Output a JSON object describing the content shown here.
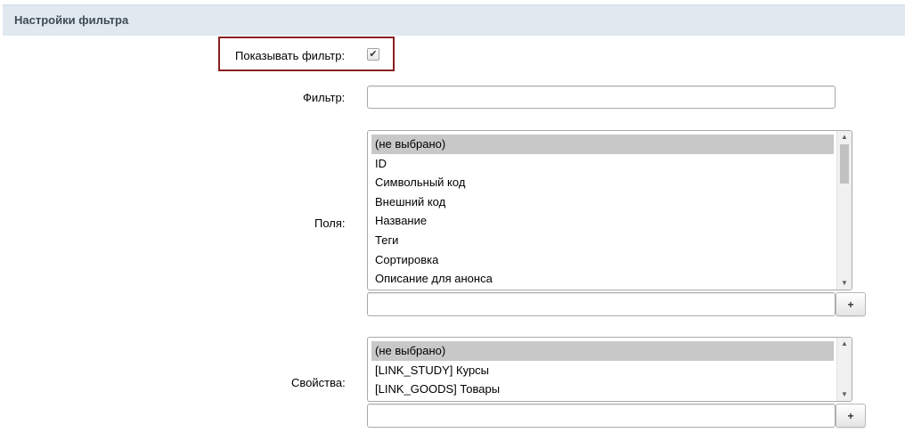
{
  "header": {
    "title": "Настройки фильтра"
  },
  "show_filter": {
    "label": "Показывать фильтр:",
    "checked": true,
    "check_glyph": "✔"
  },
  "filter": {
    "label": "Фильтр:",
    "value": ""
  },
  "fields": {
    "label": "Поля:",
    "options": [
      "(не выбрано)",
      "ID",
      "Символьный код",
      "Внешний код",
      "Название",
      "Теги",
      "Сортировка",
      "Описание для анонса"
    ],
    "selected_index": 0,
    "input_value": "",
    "add_label": "+"
  },
  "properties": {
    "label": "Свойства:",
    "options": [
      "(не выбрано)",
      "[LINK_STUDY] Курсы",
      "[LINK_GOODS] Товары"
    ],
    "selected_index": 0,
    "input_value": "",
    "add_label": "+"
  },
  "scroll": {
    "up_glyph": "▲",
    "down_glyph": "▼"
  },
  "colors": {
    "header_bg": "#e0e8f0",
    "highlight_border": "#8b1f1f",
    "selected_bg": "#c8c8c8"
  }
}
